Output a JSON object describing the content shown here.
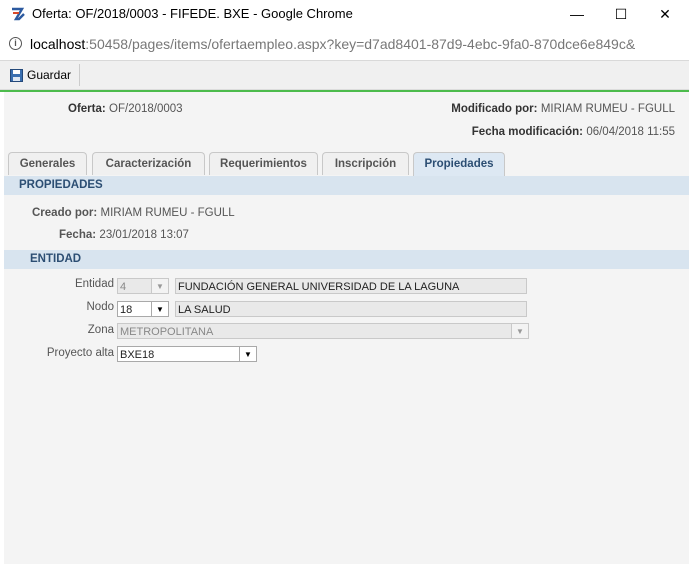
{
  "window": {
    "title": "Oferta: OF/2018/0003 - FIFEDE. BXE - Google Chrome",
    "minimize": "—",
    "maximize": "☐",
    "close": "✕"
  },
  "address": {
    "host": "localhost",
    "path": ":50458/pages/items/ofertaempleo.aspx?key=d7ad8401-87d9-4ebc-9fa0-870dce6e849c&"
  },
  "toolbar": {
    "save_label": "Guardar"
  },
  "header": {
    "oferta_label": "Oferta:",
    "oferta_value": "OF/2018/0003",
    "modificado_label": "Modificado por:",
    "modificado_value": "MIRIAM RUMEU - FGULL",
    "fecha_mod_label": "Fecha modificación:",
    "fecha_mod_value": "06/04/2018 11:55"
  },
  "tabs": [
    {
      "label": "Generales"
    },
    {
      "label": "Caracterización"
    },
    {
      "label": "Requerimientos"
    },
    {
      "label": "Inscripción"
    },
    {
      "label": "Propiedades"
    }
  ],
  "propiedades": {
    "section_title": "PROPIEDADES",
    "creado_label": "Creado por:",
    "creado_value": "MIRIAM RUMEU - FGULL",
    "fecha_label": "Fecha:",
    "fecha_value": "23/01/2018 13:07"
  },
  "entidad": {
    "section_title": "ENTIDAD",
    "entidad_label": "Entidad",
    "entidad_code": "4",
    "entidad_name": "FUNDACIÓN GENERAL UNIVERSIDAD DE LA LAGUNA",
    "nodo_label": "Nodo",
    "nodo_code": "18",
    "nodo_name": "LA SALUD",
    "zona_label": "Zona",
    "zona_value": "METROPOLITANA",
    "proyecto_label": "Proyecto alta",
    "proyecto_value": "BXE18"
  },
  "colors": {
    "accent_green": "#4cbb4c",
    "section_bg": "#d8e4ef",
    "section_text": "#2c4e73"
  }
}
